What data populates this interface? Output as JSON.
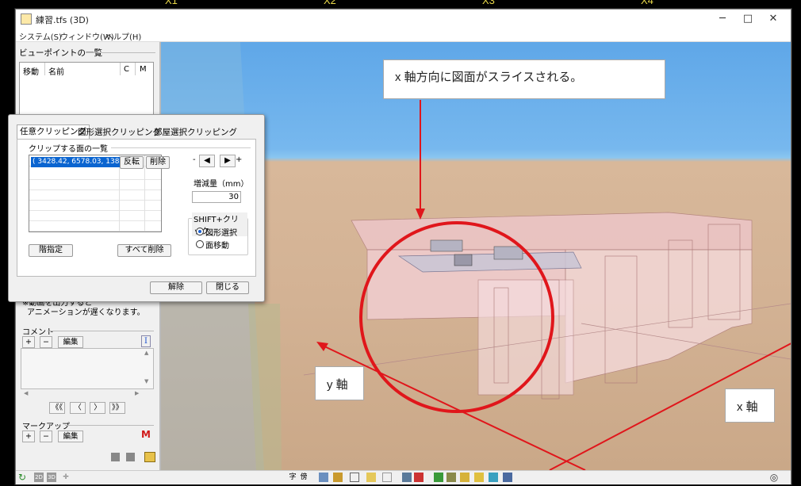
{
  "grid_labels": [
    "X1",
    "X2",
    "X3",
    "X4"
  ],
  "window": {
    "title": "練習.tfs (3D)",
    "minimize": "─",
    "maximize": "□",
    "close": "✕"
  },
  "menu": [
    "システム(S)",
    "ウィンドウ(W)",
    "ヘルプ(H)"
  ],
  "viewpoint": {
    "header": "ビューポイントの一覧",
    "columns": [
      "移動",
      "名前",
      "C",
      "M"
    ]
  },
  "note": [
    "※動画を出力すると",
    "アニメーションが遅くなります。"
  ],
  "comment": {
    "label": "コメント",
    "add": "+",
    "remove": "−",
    "edit": "編集",
    "nav": [
      "《《",
      "〈",
      "〉",
      "》》"
    ]
  },
  "markup": {
    "label": "マークアップ",
    "add": "+",
    "remove": "−",
    "edit": "編集"
  },
  "dialog": {
    "tabs": [
      "任意クリッピング",
      "図形選択クリッピング",
      "部屋選択クリッピング"
    ],
    "list_label": "クリップする面の一覧",
    "row": "( 3428.42, 6578.03, 1383.9 )",
    "reverse": "反転",
    "delete": "削除",
    "step_minus": "-",
    "step_plus": "+",
    "increment_label": "増減量（mm）",
    "increment_value": "30",
    "shift_label": "SHIFT+クリック",
    "radio_shape": "図形選択",
    "radio_move": "面移動",
    "set_floor": "階指定",
    "delete_all": "すべて削除",
    "release": "解除",
    "close": "閉じる"
  },
  "callouts": {
    "top": "x 軸方向に図面がスライスされる。",
    "y_axis": "y 軸",
    "x_axis": "x 軸"
  },
  "toolbar": {
    "char": "字",
    "bou": "傍",
    "mode2d": "2D",
    "mode3d": "3D"
  },
  "colors": {
    "annotation_red": "#e0161b",
    "selection_blue": "#0a64d0",
    "sky": "#6aaee9",
    "floor": "#d3b294"
  }
}
